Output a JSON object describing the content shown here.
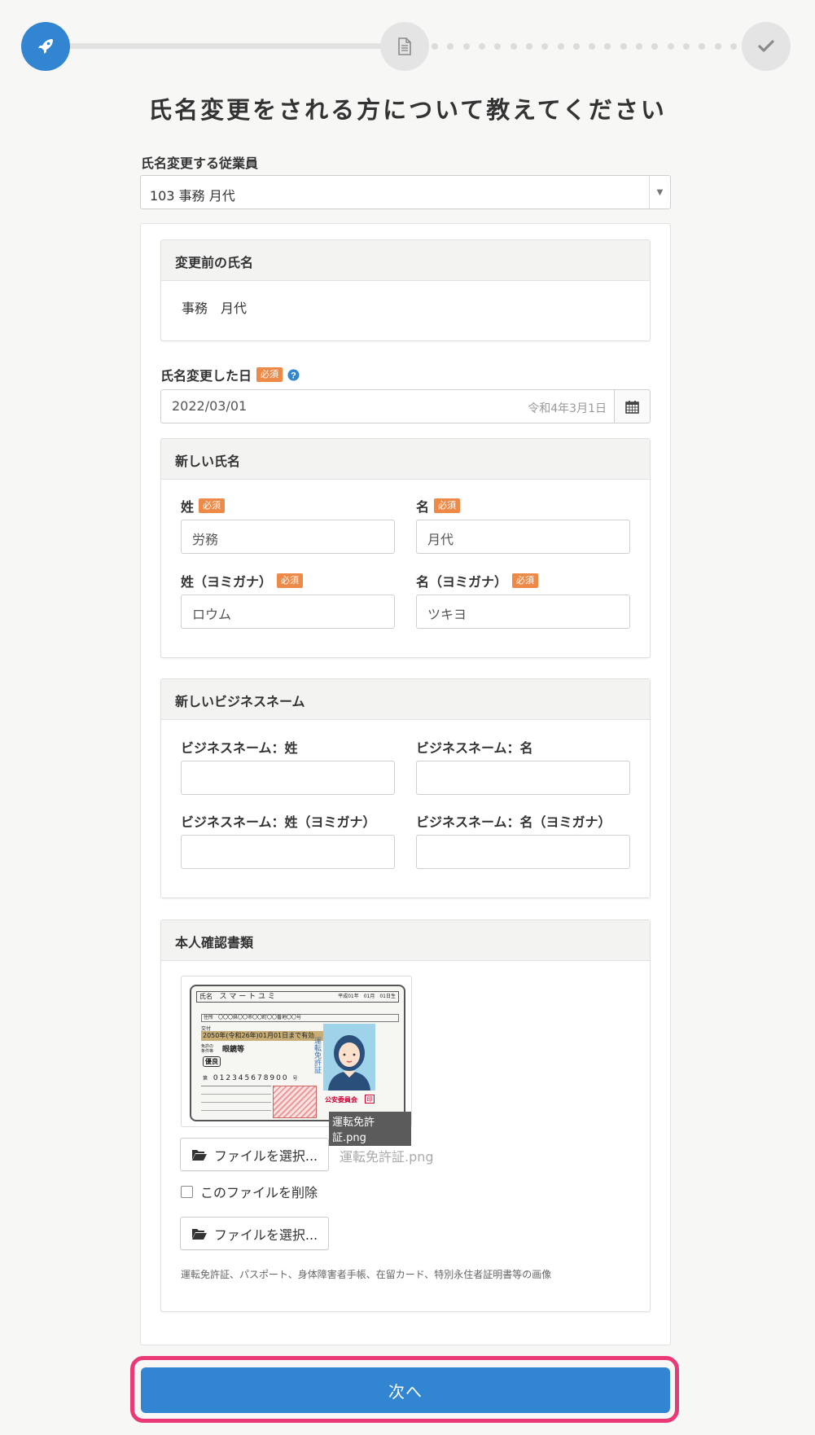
{
  "title": "氏名変更をされる方について教えてください",
  "steps": [
    {
      "name": "rocket-icon",
      "state": "active"
    },
    {
      "name": "document-icon",
      "state": "inactive"
    },
    {
      "name": "check-icon",
      "state": "inactive"
    }
  ],
  "employee": {
    "label": "氏名変更する従業員",
    "value": "103 事務 月代"
  },
  "old_name": {
    "heading": "変更前の氏名",
    "value": "事務　月代"
  },
  "change_date": {
    "label": "氏名変更した日",
    "required": "必須",
    "value": "2022/03/01",
    "era_hint": "令和4年3月1日"
  },
  "new_name": {
    "heading": "新しい氏名",
    "last_label": "姓",
    "first_label": "名",
    "last_kana_label": "姓（ヨミガナ）",
    "first_kana_label": "名（ヨミガナ）",
    "required": "必須",
    "last_value": "労務",
    "first_value": "月代",
    "last_kana_value": "ロウム",
    "first_kana_value": "ツキヨ"
  },
  "business_name": {
    "heading": "新しいビジネスネーム",
    "last_label": "ビジネスネーム：姓",
    "first_label": "ビジネスネーム：名",
    "last_kana_label": "ビジネスネーム：姓（ヨミガナ）",
    "first_kana_label": "ビジネスネーム：名（ヨミガナ）",
    "last_value": "",
    "first_value": "",
    "last_kana_value": "",
    "first_kana_value": ""
  },
  "id_docs": {
    "heading": "本人確認書類",
    "thumb_caption": "運転免許証.png",
    "license": {
      "name_label": "氏名",
      "name": "ス マ ー ト ユ ミ",
      "birth": "平成01年　01月　01日生",
      "address_label": "住所",
      "address": "〇〇〇県〇〇市〇〇町〇〇番地〇〇号",
      "issue_label": "交付",
      "expiry": "2050年(令和26年)01月01日まで有効",
      "cond_label": "免許の条件等",
      "cond": "眼鏡等",
      "grade": "優良",
      "number_prefix": "第",
      "number": "012345678900",
      "number_suffix": "号",
      "vertical_title": "運転免許証",
      "issuer": "公安委員会",
      "seal": "印"
    },
    "file_button": "ファイルを選択...",
    "file_name": "運転免許証.png",
    "delete_label": "このファイルを削除",
    "file_button2": "ファイルを選択...",
    "hint": "運転免許証、パスポート、身体障害者手帳、在留カード、特別永住者証明書等の画像"
  },
  "next_button": "次へ",
  "colors": {
    "primary": "#3185d1",
    "required_badge": "#ee8a48",
    "highlight": "#e93a77"
  }
}
